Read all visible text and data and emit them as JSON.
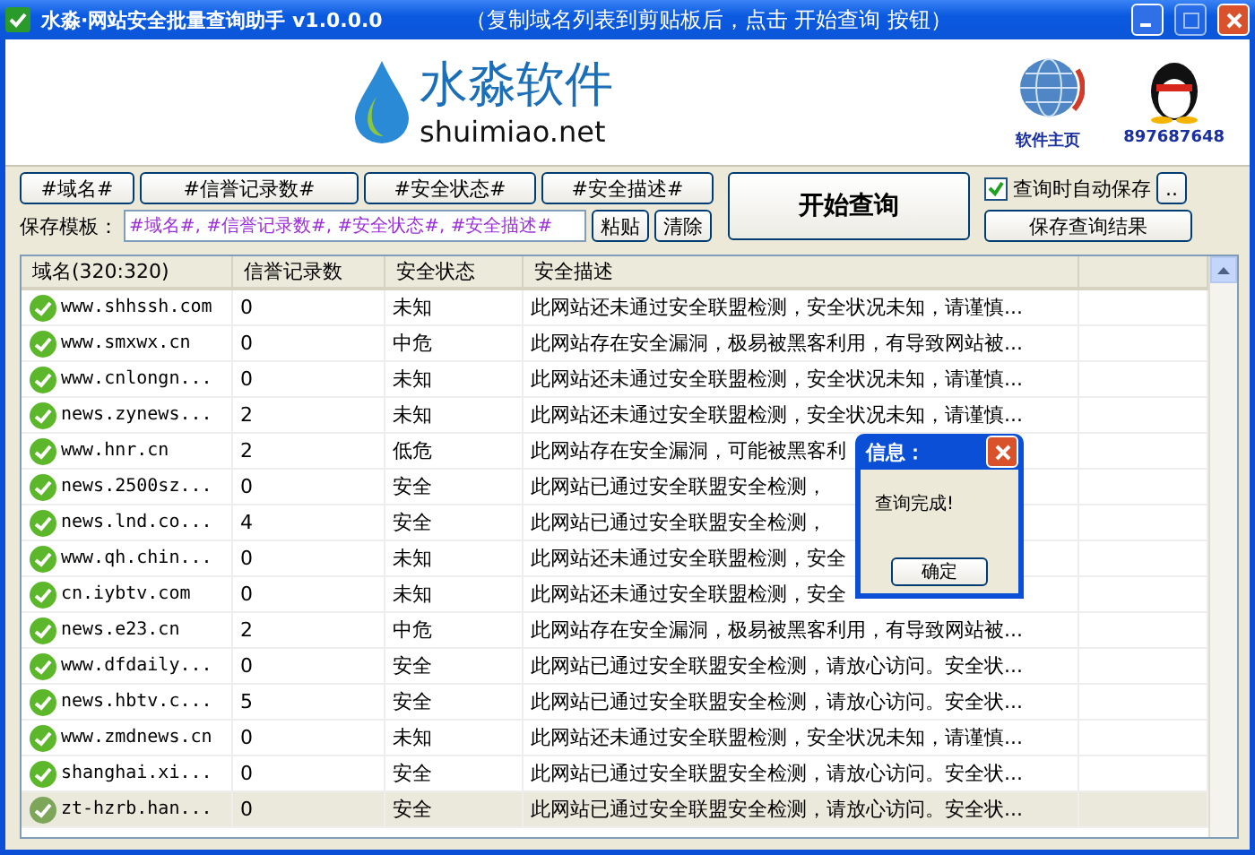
{
  "window": {
    "title": "水淼·网站安全批量查询助手 v1.0.0.0",
    "hint": "（复制域名列表到剪贴板后，点击 开始查询 按钮）"
  },
  "header": {
    "brand": "水淼软件",
    "domain": "shuimiao.net",
    "links": [
      {
        "label": "软件主页"
      },
      {
        "label": "897687648"
      }
    ]
  },
  "tokens": [
    "#域名#",
    "#信誉记录数#",
    "#安全状态#",
    "#安全描述#"
  ],
  "template": {
    "label": "保存模板：",
    "value": "#域名#, #信誉记录数#, #安全状态#, #安全描述#",
    "buttons": [
      "粘贴",
      "清除"
    ]
  },
  "start_button": "开始查询",
  "autosave": {
    "label": "查询时自动保存",
    "checked": true
  },
  "more_button": "..",
  "save_button": "保存查询结果",
  "table": {
    "columns": [
      "域名(320:320)",
      "信誉记录数",
      "安全状态",
      "安全描述"
    ],
    "rows": [
      {
        "domain": "www.shhssh.com",
        "count": "0",
        "status": "未知",
        "desc": "此网站还未通过安全联盟检测，安全状况未知，请谨慎...",
        "selected": false
      },
      {
        "domain": "www.smxwx.cn",
        "count": "0",
        "status": "中危",
        "desc": "此网站存在安全漏洞，极易被黑客利用，有导致网站被...",
        "selected": false
      },
      {
        "domain": "www.cnlongn...",
        "count": "0",
        "status": "未知",
        "desc": "此网站还未通过安全联盟检测，安全状况未知，请谨慎...",
        "selected": false
      },
      {
        "domain": "news.zynews...",
        "count": "2",
        "status": "未知",
        "desc": "此网站还未通过安全联盟检测，安全状况未知，请谨慎...",
        "selected": false
      },
      {
        "domain": "www.hnr.cn",
        "count": "2",
        "status": "低危",
        "desc": "此网站存在安全漏洞，可能被黑客利",
        "selected": false
      },
      {
        "domain": "news.2500sz...",
        "count": "0",
        "status": "安全",
        "desc": "此网站已通过安全联盟安全检测，",
        "selected": false
      },
      {
        "domain": "news.lnd.co...",
        "count": "4",
        "status": "安全",
        "desc": "此网站已通过安全联盟安全检测，",
        "selected": false
      },
      {
        "domain": "www.qh.chin...",
        "count": "0",
        "status": "未知",
        "desc": "此网站还未通过安全联盟检测，安全",
        "selected": false
      },
      {
        "domain": "cn.iybtv.com",
        "count": "0",
        "status": "未知",
        "desc": "此网站还未通过安全联盟检测，安全",
        "selected": false
      },
      {
        "domain": "news.e23.cn",
        "count": "2",
        "status": "中危",
        "desc": "此网站存在安全漏洞，极易被黑客利用，有导致网站被...",
        "selected": false
      },
      {
        "domain": "www.dfdaily...",
        "count": "0",
        "status": "安全",
        "desc": "此网站已通过安全联盟安全检测，请放心访问。安全状...",
        "selected": false
      },
      {
        "domain": "news.hbtv.c...",
        "count": "5",
        "status": "安全",
        "desc": "此网站已通过安全联盟安全检测，请放心访问。安全状...",
        "selected": false
      },
      {
        "domain": "www.zmdnews.cn",
        "count": "0",
        "status": "未知",
        "desc": "此网站还未通过安全联盟检测，安全状况未知，请谨慎...",
        "selected": false
      },
      {
        "domain": "shanghai.xi...",
        "count": "0",
        "status": "安全",
        "desc": "此网站已通过安全联盟安全检测，请放心访问。安全状...",
        "selected": false
      },
      {
        "domain": "zt-hzrb.han...",
        "count": "0",
        "status": "安全",
        "desc": "此网站已通过安全联盟安全检测，请放心访问。安全状...",
        "selected": true
      }
    ]
  },
  "dialog": {
    "title": "信息：",
    "message": "查询完成!",
    "button": "确定"
  }
}
